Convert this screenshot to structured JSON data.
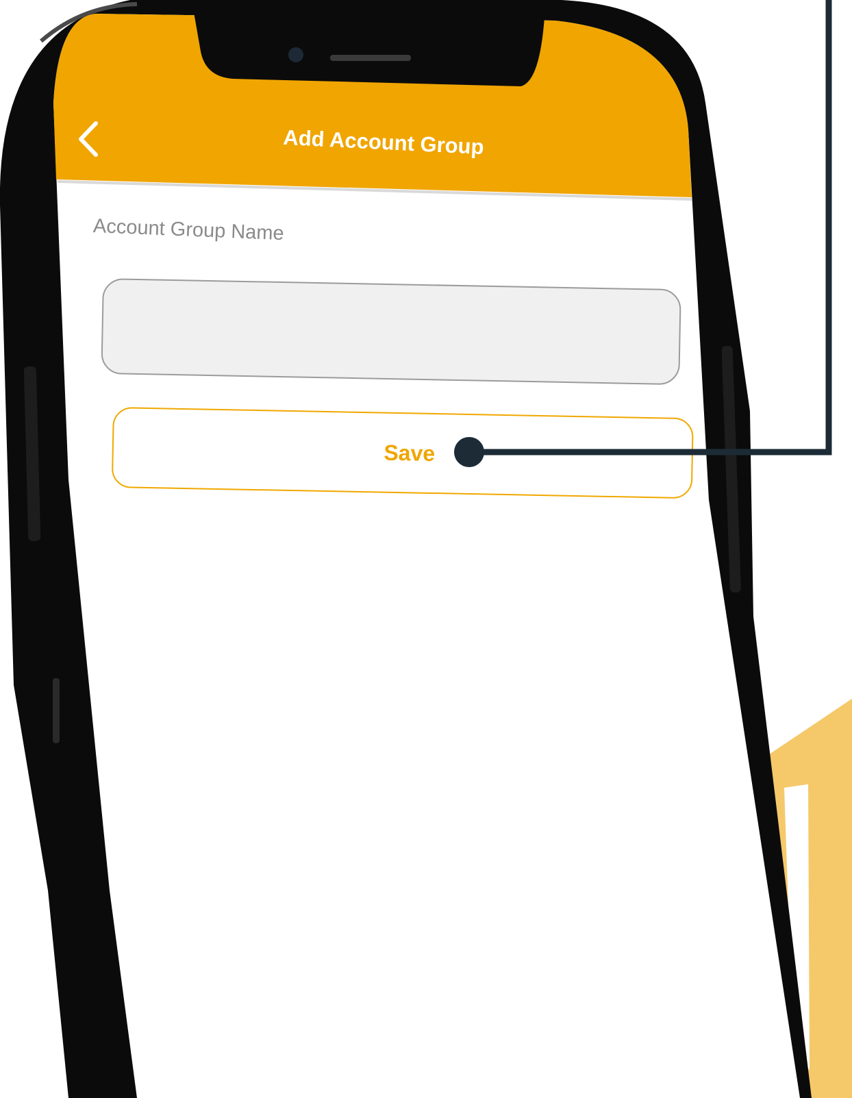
{
  "colors": {
    "accent": "#f0a500",
    "decor_yellow": "#f5c96a",
    "callout": "#1c2b36",
    "phone_frame": "#0b0b0b"
  },
  "header": {
    "title": "Add Account Group",
    "back_icon": "chevron-left-icon"
  },
  "form": {
    "label": "Account Group Name",
    "input_value": "",
    "placeholder": ""
  },
  "actions": {
    "save_label": "Save"
  }
}
